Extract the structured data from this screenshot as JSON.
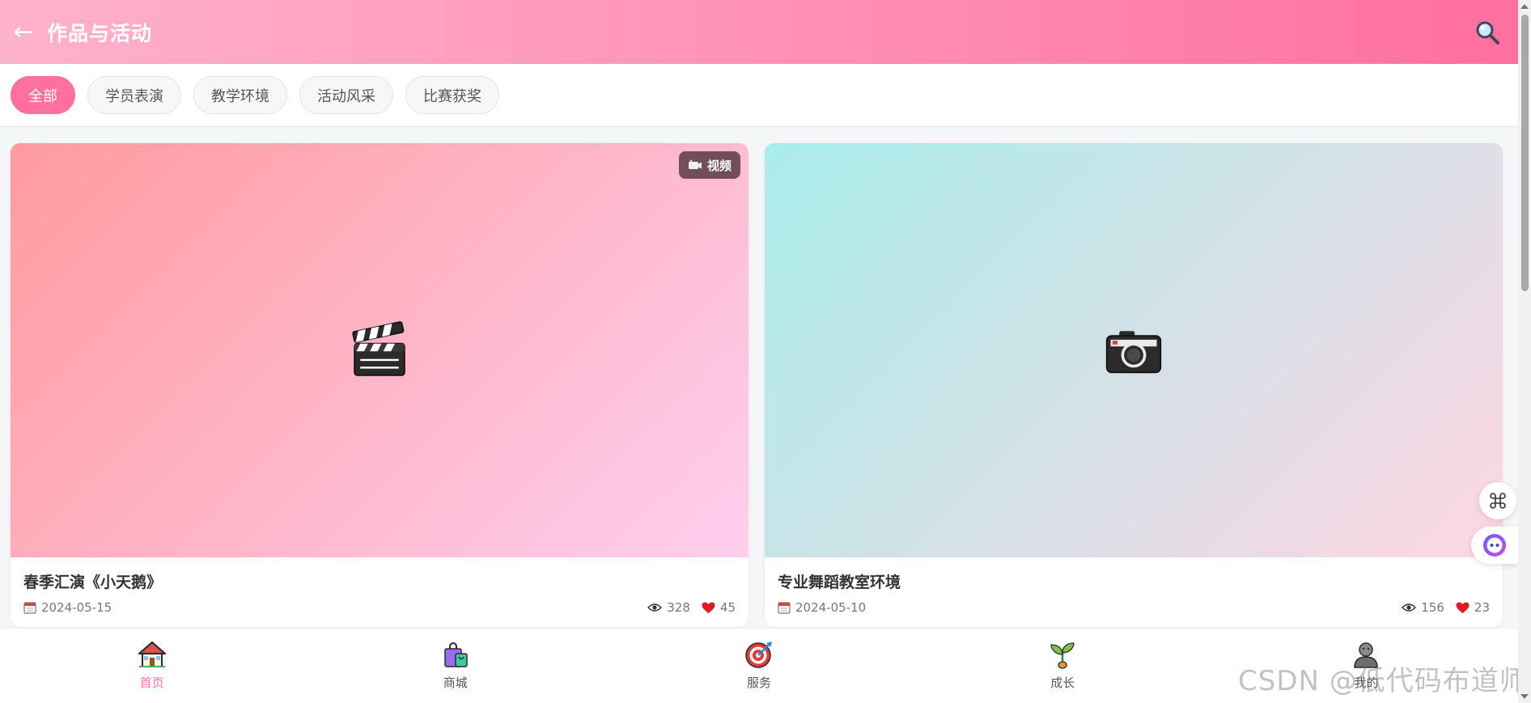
{
  "header": {
    "back_glyph": "←",
    "title": "作品与活动",
    "search_icon": "search-icon"
  },
  "tabs": [
    {
      "label": "全部",
      "active": true
    },
    {
      "label": "学员表演",
      "active": false
    },
    {
      "label": "教学环境",
      "active": false
    },
    {
      "label": "活动风采",
      "active": false
    },
    {
      "label": "比赛获奖",
      "active": false
    }
  ],
  "cards": [
    {
      "title": "春季汇演《小天鹅》",
      "date": "2024-05-15",
      "views": "328",
      "likes": "45",
      "badge": "视频",
      "thumb_icon": "clapperboard-icon"
    },
    {
      "title": "专业舞蹈教室环境",
      "date": "2024-05-10",
      "views": "156",
      "likes": "23",
      "thumb_icon": "camera-icon"
    }
  ],
  "bottom_nav": [
    {
      "label": "首页",
      "icon": "home-icon",
      "active": true
    },
    {
      "label": "商城",
      "icon": "shopping-bag-icon",
      "active": false
    },
    {
      "label": "服务",
      "icon": "target-icon",
      "active": false
    },
    {
      "label": "成长",
      "icon": "sprout-icon",
      "active": false
    },
    {
      "label": "我的",
      "icon": "person-icon",
      "active": false
    }
  ],
  "watermark": "CSDN @低代码布道师",
  "colors": {
    "accent": "#ff6f9f",
    "header_start": "#ffb2cc",
    "header_end": "#ff6f9f"
  }
}
